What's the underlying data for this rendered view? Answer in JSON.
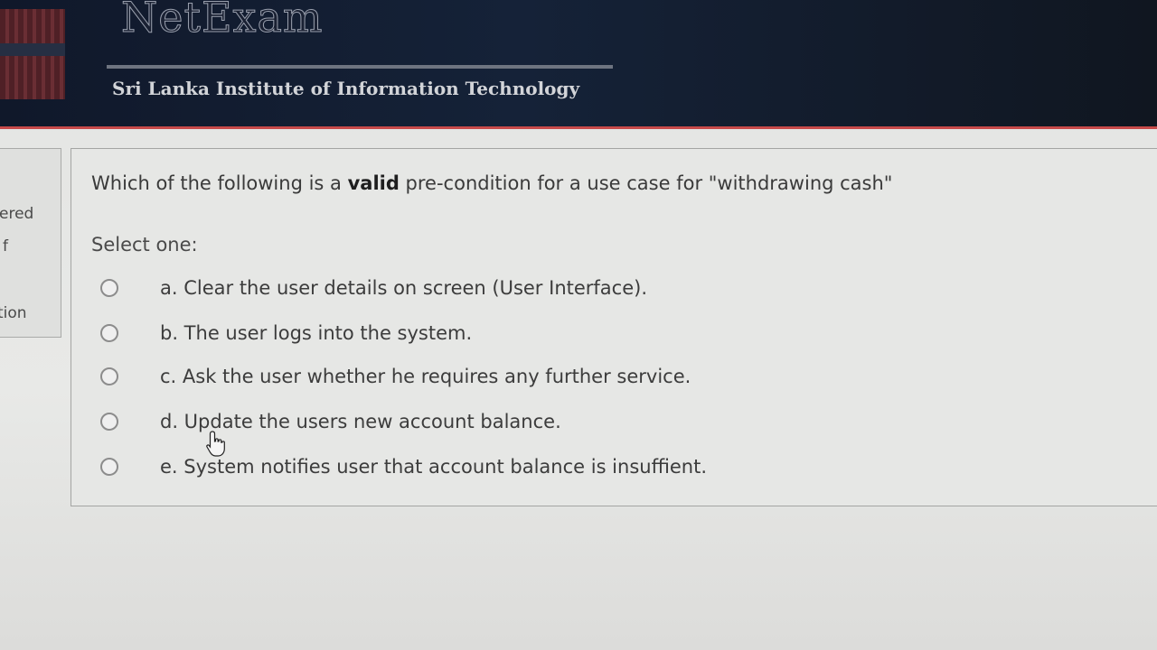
{
  "header": {
    "app_title": "NetExam",
    "institute": "Sri Lanka Institute of Information Technology",
    "colors": {
      "banner": "#152238",
      "accent": "#c84a4a"
    }
  },
  "sidebar": {
    "fragments": [
      "ered",
      "f",
      "tion"
    ]
  },
  "question": {
    "text_before": "Which of the following is a ",
    "text_bold": "valid",
    "text_after": " pre-condition for a use case for \"withdrawing cash\"",
    "prompt": "Select one:",
    "options": [
      {
        "label": "a. Clear the user details on screen (User Interface).",
        "selected": false
      },
      {
        "label": "b. The user logs into the system.",
        "selected": false
      },
      {
        "label": "c. Ask the user whether he requires any further service.",
        "selected": false
      },
      {
        "label": "d. Update the users new account balance.",
        "selected": false
      },
      {
        "label": "e. System notifies user that account balance is insuffient.",
        "selected": false
      }
    ]
  },
  "icons": {
    "cursor": "hand-pointer-icon",
    "radio": "radio-unchecked-icon"
  }
}
